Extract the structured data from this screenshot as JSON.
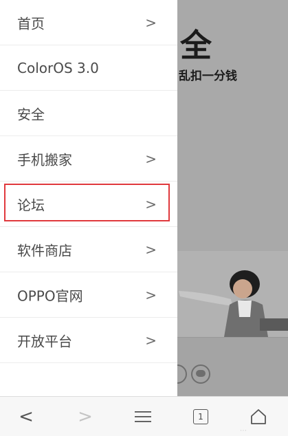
{
  "menu": {
    "items": [
      {
        "label": "首页",
        "arrow": ">"
      },
      {
        "label": "ColorOS 3.0",
        "arrow": ""
      },
      {
        "label": "安全",
        "arrow": ""
      },
      {
        "label": "手机搬家",
        "arrow": ">"
      },
      {
        "label": "论坛",
        "arrow": ">"
      },
      {
        "label": "软件商店",
        "arrow": ">"
      },
      {
        "label": "OPPO官网",
        "arrow": ">"
      },
      {
        "label": "开放平台",
        "arrow": ">"
      }
    ]
  },
  "background": {
    "headline": "全",
    "subtitle": "乱扣一分钱"
  },
  "toolbar": {
    "back": "<",
    "forward": ">",
    "tab_count": "1"
  }
}
